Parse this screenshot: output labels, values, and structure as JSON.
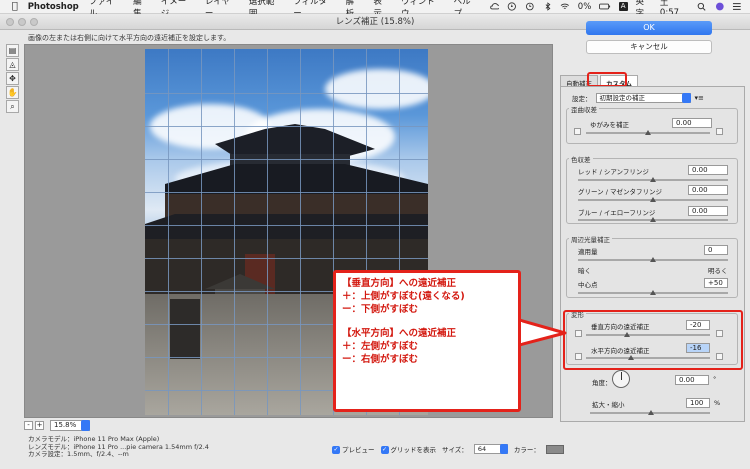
{
  "menubar": {
    "app": "Photoshop",
    "items": [
      "ファイル",
      "編集",
      "イメージ",
      "レイヤー",
      "選択範囲",
      "フィルター",
      "解析",
      "表示",
      "ウィンドウ",
      "ヘルプ"
    ],
    "battery": "0%",
    "input_mode": "英字",
    "clock": "土 0:57"
  },
  "window": {
    "title": "レンズ補正 (15.8%)"
  },
  "instruction": "画像の左または右側に向けて水平方向の遠近補正を設定します。",
  "tools": [
    "lens-tool-icon",
    "straighten-icon",
    "move-grid-icon",
    "hand-icon",
    "zoom-icon"
  ],
  "zoom": {
    "value": "15.8%",
    "minus": "-",
    "plus": "+"
  },
  "camera_info": {
    "line1": "カメラモデル：iPhone 11 Pro Max (Apple)",
    "line2": "レンズモデル：iPhone 11 Pro ...pie camera 1.54mm f/2.4",
    "line3": "カメラ設定：1.5mm、f/2.4、--m"
  },
  "bottom_options": {
    "preview": "プレビュー",
    "show_grid": "グリッドを表示",
    "size_label": "サイズ：",
    "size_value": "64",
    "color_label": "カラー："
  },
  "buttons": {
    "ok": "OK",
    "cancel": "キャンセル"
  },
  "tabs": {
    "auto": "自動補正",
    "custom": "カスタム"
  },
  "settings": {
    "label": "設定：",
    "value": "初期設定の補正"
  },
  "distortion": {
    "title": "歪曲収差",
    "label": "ゆがみを補正",
    "value": "0.00"
  },
  "chromatic": {
    "title": "色収差",
    "rows": [
      {
        "label": "レッド / シアンフリンジ",
        "value": "0.00"
      },
      {
        "label": "グリーン / マゼンタフリンジ",
        "value": "0.00"
      },
      {
        "label": "ブルー / イエローフリンジ",
        "value": "0.00"
      }
    ]
  },
  "vignette": {
    "title": "周辺光量補正",
    "amount_label": "適用量",
    "amount_value": "0",
    "dark": "暗く",
    "bright": "明るく",
    "midpoint_label": "中心点",
    "midpoint_value": "+50"
  },
  "transform": {
    "title": "変形",
    "vertical_label": "垂直方向の遠近補正",
    "vertical_value": "-20",
    "horizontal_label": "水平方向の遠近補正",
    "horizontal_value": "-16",
    "angle_label": "角度：",
    "angle_value": "0.00",
    "angle_unit": "°",
    "scale_label": "拡大・縮小",
    "scale_value": "100",
    "scale_unit": "%"
  },
  "annotation": {
    "lines": [
      "【垂直方向】への遠近補正",
      "＋：上側がすぼむ(遠くなる)",
      "ー：下側がすぼむ",
      "【水平方向】への遠近補正",
      "＋：左側がすぼむ",
      "ー：右側がすぼむ"
    ],
    "color": "#e4221a"
  }
}
